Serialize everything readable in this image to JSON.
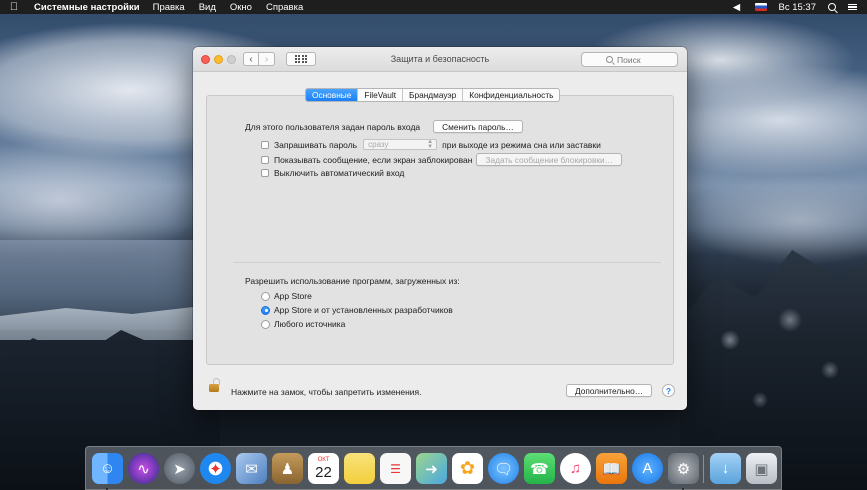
{
  "menubar": {
    "app_name": "Системные настройки",
    "items": [
      "Правка",
      "Вид",
      "Окно",
      "Справка"
    ],
    "clock": "Вс 15:37"
  },
  "window": {
    "title": "Защита и безопасность",
    "search_placeholder": "Поиск",
    "tabs": [
      {
        "label": "Основные",
        "active": true
      },
      {
        "label": "FileVault",
        "active": false
      },
      {
        "label": "Брандмауэр",
        "active": false
      },
      {
        "label": "Конфиденциальность",
        "active": false
      }
    ],
    "general": {
      "password_set_label": "Для этого пользователя задан пароль входа",
      "change_password_button": "Сменить пароль…",
      "require_password_label": "Запрашивать пароль",
      "require_password_delay": "сразу",
      "require_password_suffix": "при выходе из режима сна или заставки",
      "show_message_label": "Показывать сообщение, если экран заблокирован",
      "set_message_button": "Задать сообщение блокировки…",
      "disable_autologin_label": "Выключить автоматический вход",
      "allow_apps_label": "Разрешить использование программ, загруженных из:",
      "options": [
        {
          "label": "App Store",
          "selected": false
        },
        {
          "label": "App Store и от установленных разработчиков",
          "selected": true
        },
        {
          "label": "Любого источника",
          "selected": false
        }
      ]
    },
    "footer": {
      "lock_text": "Нажмите на замок, чтобы запретить изменения.",
      "advanced_button": "Дополнительно…",
      "help_label": "?"
    }
  },
  "dock": {
    "calendar_month": "ОКТ",
    "calendar_day": "22",
    "apps": [
      {
        "name": "finder",
        "color": "#3d8ef5"
      },
      {
        "name": "siri",
        "color": "#5a3fd6"
      },
      {
        "name": "launchpad",
        "color": "#5b6470"
      },
      {
        "name": "safari",
        "color": "#1e88f0"
      },
      {
        "name": "mail",
        "color": "#5d8fd0"
      },
      {
        "name": "contacts",
        "color": "#b08a4e"
      },
      {
        "name": "calendar",
        "color": "#ffffff"
      },
      {
        "name": "notes",
        "color": "#f7de6a"
      },
      {
        "name": "reminders",
        "color": "#f4f4f4"
      },
      {
        "name": "maps",
        "color": "#6fbf6b"
      },
      {
        "name": "photos",
        "color": "#ffffff"
      },
      {
        "name": "messages",
        "color": "#2f9bf5"
      },
      {
        "name": "facetime",
        "color": "#3ac755"
      },
      {
        "name": "itunes",
        "color": "#fb3f6c"
      },
      {
        "name": "ibooks",
        "color": "#f08b1f"
      },
      {
        "name": "app-store",
        "color": "#1a8af0"
      },
      {
        "name": "system-preferences",
        "color": "#7a7f87"
      },
      {
        "name": "downloads",
        "color": "#7fb8e8"
      },
      {
        "name": "trash",
        "color": "#d9dde2"
      }
    ]
  }
}
